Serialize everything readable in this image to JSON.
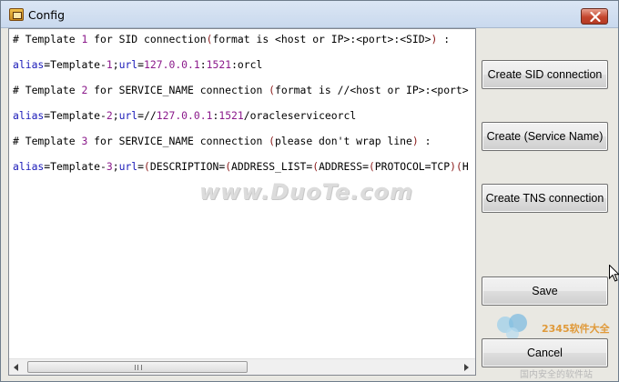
{
  "window": {
    "title": "Config",
    "icon": "app-database-icon",
    "close_icon": "close-icon"
  },
  "editor": {
    "lines": [
      [
        {
          "t": "# Template ",
          "c": ""
        },
        {
          "t": "1",
          "c": "c-purple"
        },
        {
          "t": " for SID connection",
          "c": ""
        },
        {
          "t": "(",
          "c": "c-red"
        },
        {
          "t": "format is <host or IP>:<port>:<SID>",
          "c": ""
        },
        {
          "t": ")",
          "c": "c-red"
        },
        {
          "t": " :",
          "c": ""
        }
      ],
      [],
      [
        {
          "t": "alias",
          "c": "c-blue"
        },
        {
          "t": "=Template-",
          "c": ""
        },
        {
          "t": "1",
          "c": "c-purple"
        },
        {
          "t": ";",
          "c": ""
        },
        {
          "t": "url",
          "c": "c-blue"
        },
        {
          "t": "=",
          "c": ""
        },
        {
          "t": "127.0.0.1",
          "c": "c-purple"
        },
        {
          "t": ":",
          "c": ""
        },
        {
          "t": "1521",
          "c": "c-purple"
        },
        {
          "t": ":orcl",
          "c": ""
        }
      ],
      [],
      [
        {
          "t": "# Template ",
          "c": ""
        },
        {
          "t": "2",
          "c": "c-purple"
        },
        {
          "t": " for SERVICE_NAME connection ",
          "c": ""
        },
        {
          "t": "(",
          "c": "c-red"
        },
        {
          "t": "format is //<host or IP>:<port>",
          "c": ""
        }
      ],
      [],
      [
        {
          "t": "alias",
          "c": "c-blue"
        },
        {
          "t": "=Template-",
          "c": ""
        },
        {
          "t": "2",
          "c": "c-purple"
        },
        {
          "t": ";",
          "c": ""
        },
        {
          "t": "url",
          "c": "c-blue"
        },
        {
          "t": "=//",
          "c": ""
        },
        {
          "t": "127.0.0.1",
          "c": "c-purple"
        },
        {
          "t": ":",
          "c": ""
        },
        {
          "t": "1521",
          "c": "c-purple"
        },
        {
          "t": "/oracleserviceorcl",
          "c": ""
        }
      ],
      [],
      [
        {
          "t": "# Template ",
          "c": ""
        },
        {
          "t": "3",
          "c": "c-purple"
        },
        {
          "t": " for SERVICE_NAME connection ",
          "c": ""
        },
        {
          "t": "(",
          "c": "c-red"
        },
        {
          "t": "please don't wrap line",
          "c": ""
        },
        {
          "t": ")",
          "c": "c-red"
        },
        {
          "t": " :",
          "c": ""
        }
      ],
      [],
      [
        {
          "t": "alias",
          "c": "c-blue"
        },
        {
          "t": "=Template-",
          "c": ""
        },
        {
          "t": "3",
          "c": "c-purple"
        },
        {
          "t": ";",
          "c": ""
        },
        {
          "t": "url",
          "c": "c-blue"
        },
        {
          "t": "=",
          "c": ""
        },
        {
          "t": "(",
          "c": "c-red"
        },
        {
          "t": "DESCRIPTION=",
          "c": ""
        },
        {
          "t": "(",
          "c": "c-red"
        },
        {
          "t": "ADDRESS_LIST=",
          "c": ""
        },
        {
          "t": "(",
          "c": "c-red"
        },
        {
          "t": "ADDRESS=",
          "c": ""
        },
        {
          "t": "(",
          "c": "c-red"
        },
        {
          "t": "PROTOCOL=TCP",
          "c": ""
        },
        {
          "t": ")",
          "c": "c-red"
        },
        {
          "t": "(",
          "c": "c-red"
        },
        {
          "t": "H",
          "c": ""
        }
      ]
    ],
    "scrollbar": {
      "left_arrow": "scroll-left-icon",
      "right_arrow": "scroll-right-icon",
      "grip": "|||"
    }
  },
  "buttons": {
    "create_sid": "Create SID connection",
    "create_service": "Create (Service Name)",
    "create_tns": "Create TNS connection",
    "save": "Save",
    "cancel": "Cancel"
  },
  "watermark": {
    "text": "www.DuoTe.com"
  },
  "logo": {
    "text": "2345软件大全",
    "sub": "国内安全的软件站"
  },
  "colors": {
    "comment_text": "#000000",
    "keyword_blue": "#1a1ab8",
    "number_purple": "#8b1a8b",
    "paren_red": "#8a1a1a",
    "window_bg": "#e9e8e2",
    "titlebar": "#c9d9ee",
    "close_button": "#c4452d"
  }
}
